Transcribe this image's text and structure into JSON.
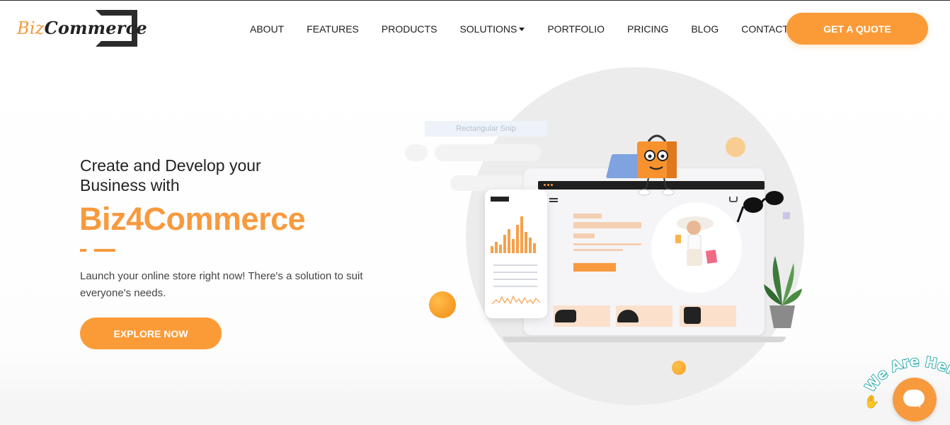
{
  "header": {
    "logo": {
      "part1": "Biz",
      "part2": "Commerce"
    },
    "nav": [
      {
        "label": "ABOUT",
        "dropdown": false
      },
      {
        "label": "FEATURES",
        "dropdown": false
      },
      {
        "label": "PRODUCTS",
        "dropdown": false
      },
      {
        "label": "SOLUTIONS",
        "dropdown": true
      },
      {
        "label": "PORTFOLIO",
        "dropdown": false
      },
      {
        "label": "PRICING",
        "dropdown": false
      },
      {
        "label": "BLOG",
        "dropdown": false
      },
      {
        "label": "CONTACT US",
        "dropdown": false
      }
    ],
    "cta_label": "GET A QUOTE"
  },
  "hero": {
    "heading_line1": "Create and Develop your",
    "heading_line2": "Business with",
    "brand": "Biz4Commerce",
    "description": "Launch your online store right now! There's a solution to suit everyone's needs.",
    "button_label": "EXPLORE NOW"
  },
  "illustration": {
    "snip_label": "Rectangular Snip"
  },
  "chat": {
    "banner": "We Are Here!",
    "icon": "chat-bubble-icon"
  },
  "colors": {
    "accent": "#fb9b38",
    "brand_orange": "#f79a3e",
    "text_dark": "#222222",
    "chat_outline": "#1aa6a6"
  }
}
